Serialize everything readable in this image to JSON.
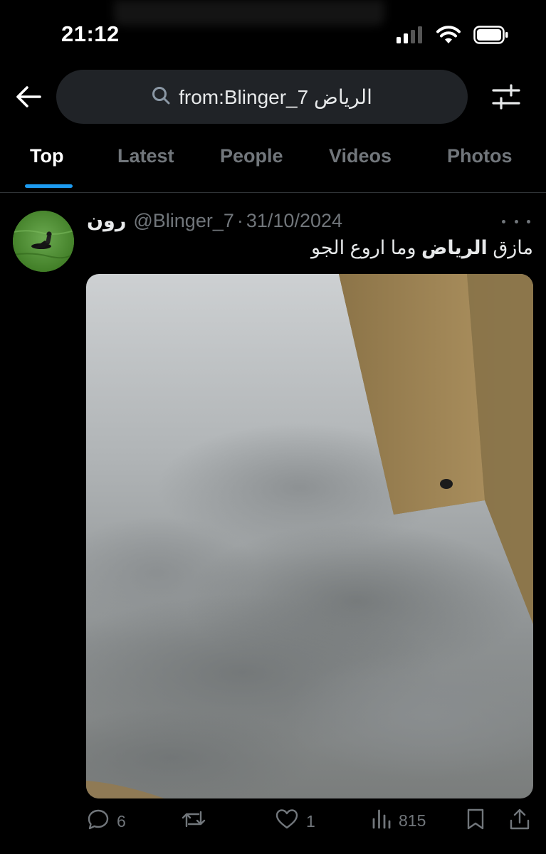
{
  "status_bar": {
    "time": "21:12",
    "icons": [
      "signal-icon",
      "wifi-icon",
      "battery-icon"
    ]
  },
  "search": {
    "query": "from:Blinger_7 الرياض",
    "icons": [
      "back-arrow-icon",
      "search-icon",
      "filter-icon"
    ]
  },
  "tabs": [
    {
      "label": "Top",
      "active": true
    },
    {
      "label": "Latest",
      "active": false
    },
    {
      "label": "People",
      "active": false
    },
    {
      "label": "Videos",
      "active": false
    },
    {
      "label": "Photos",
      "active": false
    }
  ],
  "tweet": {
    "display_name": "رون",
    "handle": "@Blinger_7",
    "separator": "·",
    "date": "31/10/2024",
    "text_before": "مازق ",
    "text_bold": "الرياض",
    "text_after": " وما اروع الجو",
    "media_description_icon": "photo-cloudy-sky",
    "stats": {
      "replies": "6",
      "reposts": "",
      "likes": "1",
      "views": "815"
    }
  },
  "colors": {
    "background": "#000000",
    "accent": "#1d9bf0",
    "search_fill": "#202327",
    "muted_text": "#71767b",
    "divider": "#2f3336"
  }
}
